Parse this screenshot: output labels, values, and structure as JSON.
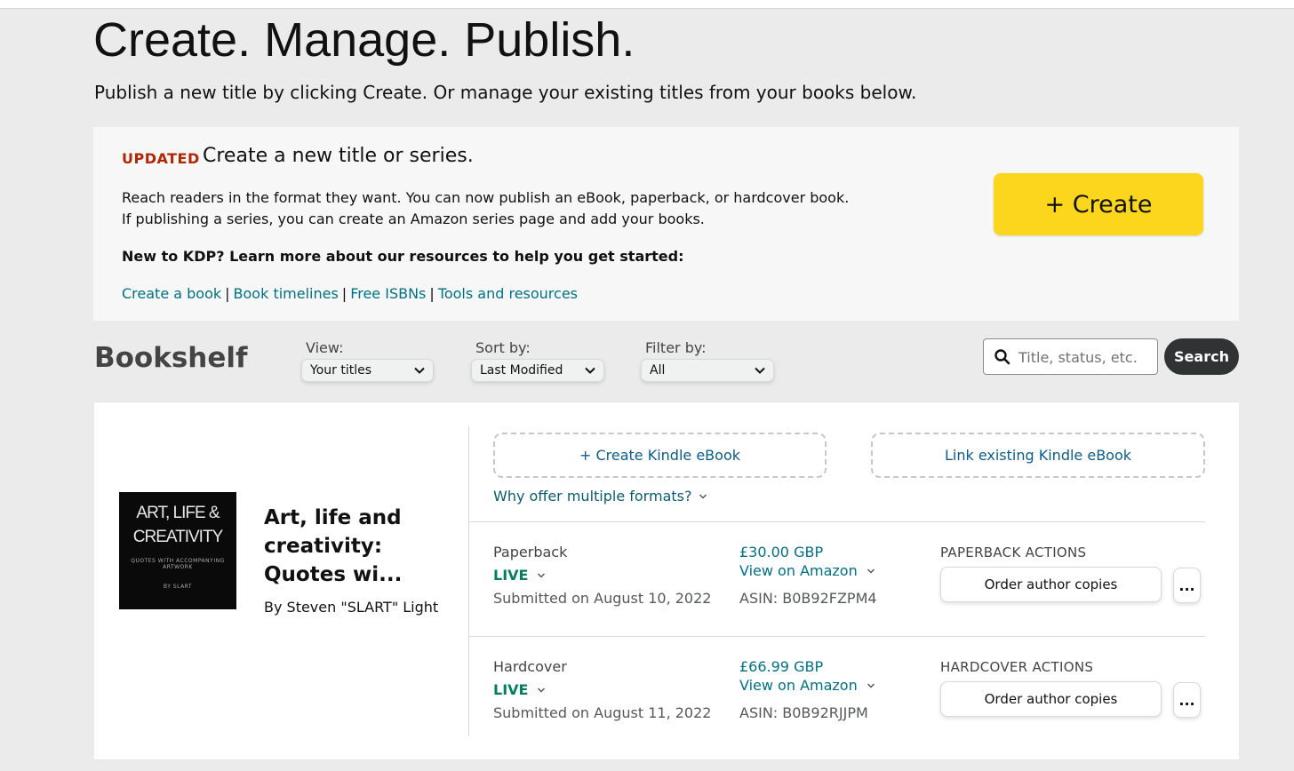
{
  "header": {
    "title": "Create. Manage. Publish.",
    "subtitle": "Publish a new title by clicking Create. Or manage your existing titles from your books below."
  },
  "create_panel": {
    "badge": "UPDATED",
    "title": "Create a new title or series.",
    "description": "Reach readers in the format they want. You can now publish an eBook, paperback, or hardcover book. If publishing a series, you can create an Amazon series page and add your books.",
    "new_to_kdp": "New to KDP? Learn more about our resources to help you get started:",
    "links": [
      "Create a book",
      "Book timelines",
      "Free ISBNs",
      "Tools and resources"
    ],
    "separator": "|",
    "create_button": "+ Create",
    "create_button_color": "#fcd61c"
  },
  "bookshelf": {
    "title": "Bookshelf",
    "view_label": "View:",
    "view_value": "Your titles",
    "sort_label": "Sort by:",
    "sort_value": "Last Modified",
    "filter_label": "Filter by:",
    "filter_value": "All",
    "search_placeholder": "Title, status, etc.",
    "search_button": "Search"
  },
  "book": {
    "cover_lines": [
      "ART, LIFE &",
      "CREATIVITY",
      "QUOTES WITH ACCOMPANYING ARTWORK",
      "BY SLART"
    ],
    "title": "Art, life and creativity: Quotes wi...",
    "author": "By Steven \"SLART\" Light",
    "create_kindle": "+ Create Kindle eBook",
    "link_kindle": "Link existing Kindle eBook",
    "why_formats": "Why offer multiple formats?",
    "formats": [
      {
        "name": "Paperback",
        "status": "LIVE",
        "submitted": "Submitted on August 10, 2022",
        "price": "£30.00 GBP",
        "view": "View on Amazon",
        "asin": "ASIN: B0B92FZPM4",
        "actions_label": "PAPERBACK ACTIONS",
        "order_button": "Order author copies",
        "more_button": "..."
      },
      {
        "name": "Hardcover",
        "status": "LIVE",
        "submitted": "Submitted on August 11, 2022",
        "price": "£66.99 GBP",
        "view": "View on Amazon",
        "asin": "ASIN: B0B92RJJPM",
        "actions_label": "HARDCOVER ACTIONS",
        "order_button": "Order author copies",
        "more_button": "..."
      }
    ]
  },
  "colors": {
    "link": "#007185",
    "live": "#067d62",
    "updated": "#b12704"
  }
}
